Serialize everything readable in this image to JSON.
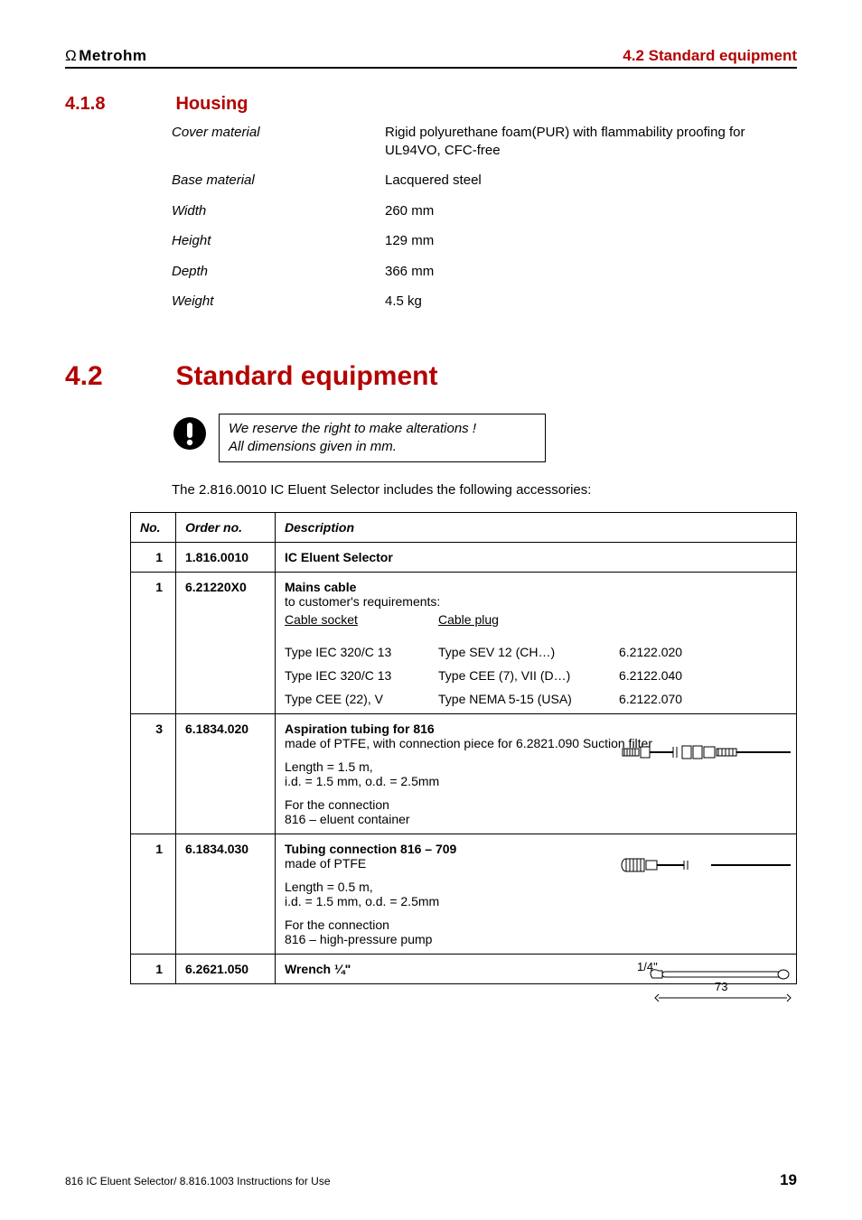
{
  "header": {
    "brand_prefix": "Ω",
    "brand_bold": "Metrohm",
    "section_ref": "4.2 Standard equipment"
  },
  "subsection": {
    "number": "4.1.8",
    "title": "Housing"
  },
  "specs": [
    {
      "label": "Cover material",
      "value": "Rigid polyurethane foam(PUR) with flammability proofing for UL94VO, CFC-free"
    },
    {
      "label": "Base material",
      "value": "Lacquered steel"
    },
    {
      "label": "Width",
      "value": "260 mm"
    },
    {
      "label": "Height",
      "value": "129 mm"
    },
    {
      "label": "Depth",
      "value": "366 mm"
    },
    {
      "label": "Weight",
      "value": "4.5 kg"
    }
  ],
  "section": {
    "number": "4.2",
    "title": "Standard equipment"
  },
  "note": {
    "line1": "We reserve the right to make alterations !",
    "line2": "All dimensions given in mm."
  },
  "intro": "The 2.816.0010 IC Eluent Selector includes the following accessories:",
  "table": {
    "headers": {
      "no": "No.",
      "order": "Order no.",
      "desc": "Description"
    },
    "rows": [
      {
        "no": "1",
        "order": "1.816.0010",
        "title": "IC Eluent Selector"
      },
      {
        "no": "1",
        "order": "6.21220X0",
        "title": "Mains cable",
        "sub": "to customer's requirements:",
        "col_heads": {
          "a": "Cable socket",
          "b": "Cable plug"
        },
        "lines": [
          {
            "a": "Type IEC 320/C 13",
            "b": "Type SEV 12 (CH…)",
            "c": "6.2122.020"
          },
          {
            "a": "Type IEC 320/C 13",
            "b": "Type CEE (7), VII (D…)",
            "c": "6.2122.040"
          },
          {
            "a": "Type CEE (22), V",
            "b": "Type NEMA 5-15 (USA)",
            "c": "6.2122.070"
          }
        ]
      },
      {
        "no": "3",
        "order": "6.1834.020",
        "title": "Aspiration tubing for 816",
        "body1": "made of PTFE, with connection piece for 6.2821.090 Suction filter",
        "body2": "Length = 1.5 m,\ni.d. = 1.5 mm, o.d. = 2.5mm",
        "body3": "For the connection\n816 – eluent container"
      },
      {
        "no": "1",
        "order": "6.1834.030",
        "title": "Tubing connection 816 – 709",
        "body1": "made of PTFE",
        "body2": "Length = 0.5 m,\ni.d. = 1.5 mm, o.d. = 2.5mm",
        "body3": "For the connection\n816 – high-pressure pump"
      },
      {
        "no": "1",
        "order": "6.2621.050",
        "title": "Wrench ¼\"",
        "wrench_label_top": "1/4\"",
        "wrench_label_bottom": "73"
      }
    ]
  },
  "footer": {
    "left": "816 IC Eluent Selector/ 8.816.1003 Instructions for Use",
    "page": "19"
  }
}
